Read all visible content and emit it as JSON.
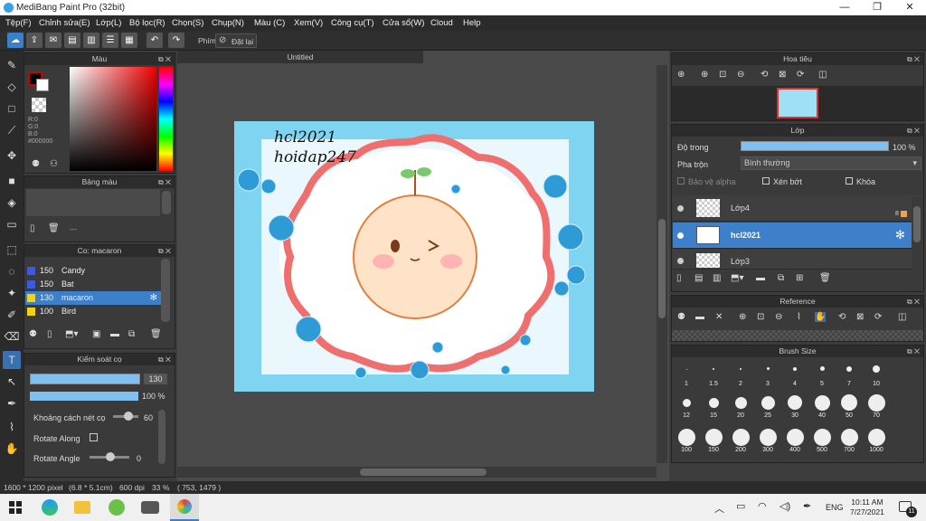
{
  "window": {
    "title": "MediBang Paint Pro (32bit)",
    "min": "—",
    "max": "❐",
    "close": "✕"
  },
  "menu": [
    "Tệp(F)",
    "Chỉnh sửa(E)",
    "Lớp(L)",
    "Bộ lọc(R)",
    "Chọn(S)",
    "Chụp(N)",
    "Màu (C)",
    "Xem(V)",
    "Công cụ(T)",
    "Cửa sổ(W)",
    "Cloud",
    "Help"
  ],
  "toolbar": {
    "shortcut_label": "Phím",
    "reset_label": "Đặt lại"
  },
  "color_panel": {
    "title": "Màu",
    "r": "R:0",
    "g": "G:0",
    "b": "B:0",
    "hex": "#000000"
  },
  "palette_panel": {
    "title": "Bảng màu",
    "more": "---"
  },
  "swatch_panel": {
    "title": "Co: macaron",
    "items": [
      {
        "num": "150",
        "label": "Candy",
        "color": "#3a5be0"
      },
      {
        "num": "150",
        "label": "Bat",
        "color": "#3a5be0"
      },
      {
        "num": "130",
        "label": "macaron",
        "color": "#f2d31a",
        "selected": true
      },
      {
        "num": "100",
        "label": "Bird",
        "color": "#f2d31a"
      }
    ]
  },
  "brush_control": {
    "title": "Kiểm soát cọ",
    "size": "130",
    "opacity": "100 %",
    "spacing_label": "Khoảng cách nét cọ",
    "spacing": "60",
    "rotate_along": "Rotate Along",
    "rotate_angle": "Rotate Angle",
    "angle": "0"
  },
  "canvas": {
    "tab": "Untitled",
    "text1": "hcl2021",
    "text2": "hoidap247"
  },
  "navigator": {
    "title": "Hoa tiêu"
  },
  "layer_panel": {
    "title": "Lớp",
    "opacity_label": "Độ trong",
    "opacity": "100 %",
    "blend_label": "Pha trộn",
    "blend": "Bình thường",
    "protect_alpha": "Bảo vệ alpha",
    "clip": "Xén bớt",
    "lock": "Khóa",
    "layers": [
      {
        "name": "Lớp4",
        "selected": false
      },
      {
        "name": "hcl2021",
        "selected": true
      },
      {
        "name": "Lớp3",
        "selected": false
      }
    ]
  },
  "reference_panel": {
    "title": "Reference"
  },
  "brush_size_panel": {
    "title": "Brush Size",
    "sizes": [
      "1",
      "1.5",
      "2",
      "3",
      "4",
      "5",
      "7",
      "10",
      "12",
      "15",
      "20",
      "25",
      "30",
      "40",
      "50",
      "70",
      "100",
      "150",
      "200",
      "300",
      "400",
      "500",
      "700",
      "1000"
    ]
  },
  "status": {
    "dims": "1600 * 1200 pixel",
    "cm": "(6.8 * 5.1cm)",
    "dpi": "600 dpi",
    "zoom": "33 %",
    "coords": "( 753, 1479 )"
  },
  "taskbar": {
    "lang": "ENG",
    "time": "10:11 AM",
    "date": "7/27/2021",
    "notif": "11"
  }
}
